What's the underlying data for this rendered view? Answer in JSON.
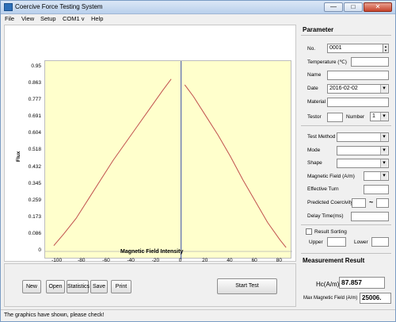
{
  "window": {
    "title": "Coercive Force Testing System",
    "min_glyph": "—",
    "max_glyph": "□",
    "close_glyph": "✕"
  },
  "menu": [
    "File",
    "View",
    "Setup",
    "COM1 v",
    "Help"
  ],
  "chart_data": {
    "type": "line",
    "xlabel": "Magnetic Field Intensity",
    "ylabel": "Flux",
    "xlim": [
      -110,
      90
    ],
    "ylim": [
      0,
      0.95
    ],
    "xticks": [
      -100,
      -80,
      -60,
      -40,
      -20,
      0,
      20,
      40,
      60,
      80
    ],
    "yticks": [
      0,
      0.086,
      0.173,
      0.259,
      0.345,
      0.432,
      0.518,
      0.604,
      0.691,
      0.777,
      0.863,
      0.95
    ],
    "grid": false,
    "series": [
      {
        "color": "#c0504d",
        "x": [
          -103,
          -95,
          -85,
          -75,
          -65,
          -55,
          -45,
          -35,
          -25,
          -15,
          -8
        ],
        "y": [
          0.03,
          0.09,
          0.17,
          0.27,
          0.37,
          0.47,
          0.56,
          0.65,
          0.74,
          0.83,
          0.89
        ]
      },
      {
        "color": "#c0504d",
        "x": [
          3,
          10,
          20,
          30,
          40,
          50,
          60,
          70,
          80,
          85
        ],
        "y": [
          0.86,
          0.8,
          0.7,
          0.6,
          0.49,
          0.37,
          0.26,
          0.15,
          0.06,
          0.02
        ]
      }
    ]
  },
  "buttons": {
    "new": "New",
    "open": "Open",
    "statistics": "Statistics",
    "save": "Save",
    "print": "Print",
    "start_test": "Start Test"
  },
  "parameter": {
    "title": "Parameter",
    "no_label": "No.",
    "no_value": "0001",
    "temperature_label": "Temperature (℃)",
    "temperature_value": "",
    "name_label": "Name",
    "name_value": "",
    "date_label": "Date",
    "date_value": "2016-02-02",
    "material_label": "Material",
    "material_value": "",
    "testor_label": "Testor",
    "testor_value": "",
    "number_label": "Number",
    "number_value": "1",
    "test_method_label": "Test Method",
    "test_method_value": "",
    "mode_label": "Mode",
    "mode_value": "",
    "shape_label": "Shape",
    "shape_value": "",
    "magnetic_field_label": "Magnetic Field (A/m)",
    "magnetic_field_value": "",
    "effective_turn_label": "Effective Turn",
    "effective_turn_value": "",
    "predicted_coercivity_label": "Predicted Coercivity",
    "predicted_from": "",
    "predicted_to": "",
    "range_sep": "~",
    "delay_time_label": "Delay Time(ms)",
    "delay_time_value": "",
    "result_sorting_label": "Result Sorting",
    "upper_label": "Upper",
    "upper_value": "",
    "lower_label": "Lower",
    "lower_value": ""
  },
  "measurement": {
    "title": "Measurement Result",
    "hc_label": "Hc(A/m)",
    "hc_value": "87.857",
    "max_field_label": "Max Magnetic Field (A/m)",
    "max_field_value": "25006."
  },
  "status": {
    "message": "The graphics have shown, please check!"
  }
}
